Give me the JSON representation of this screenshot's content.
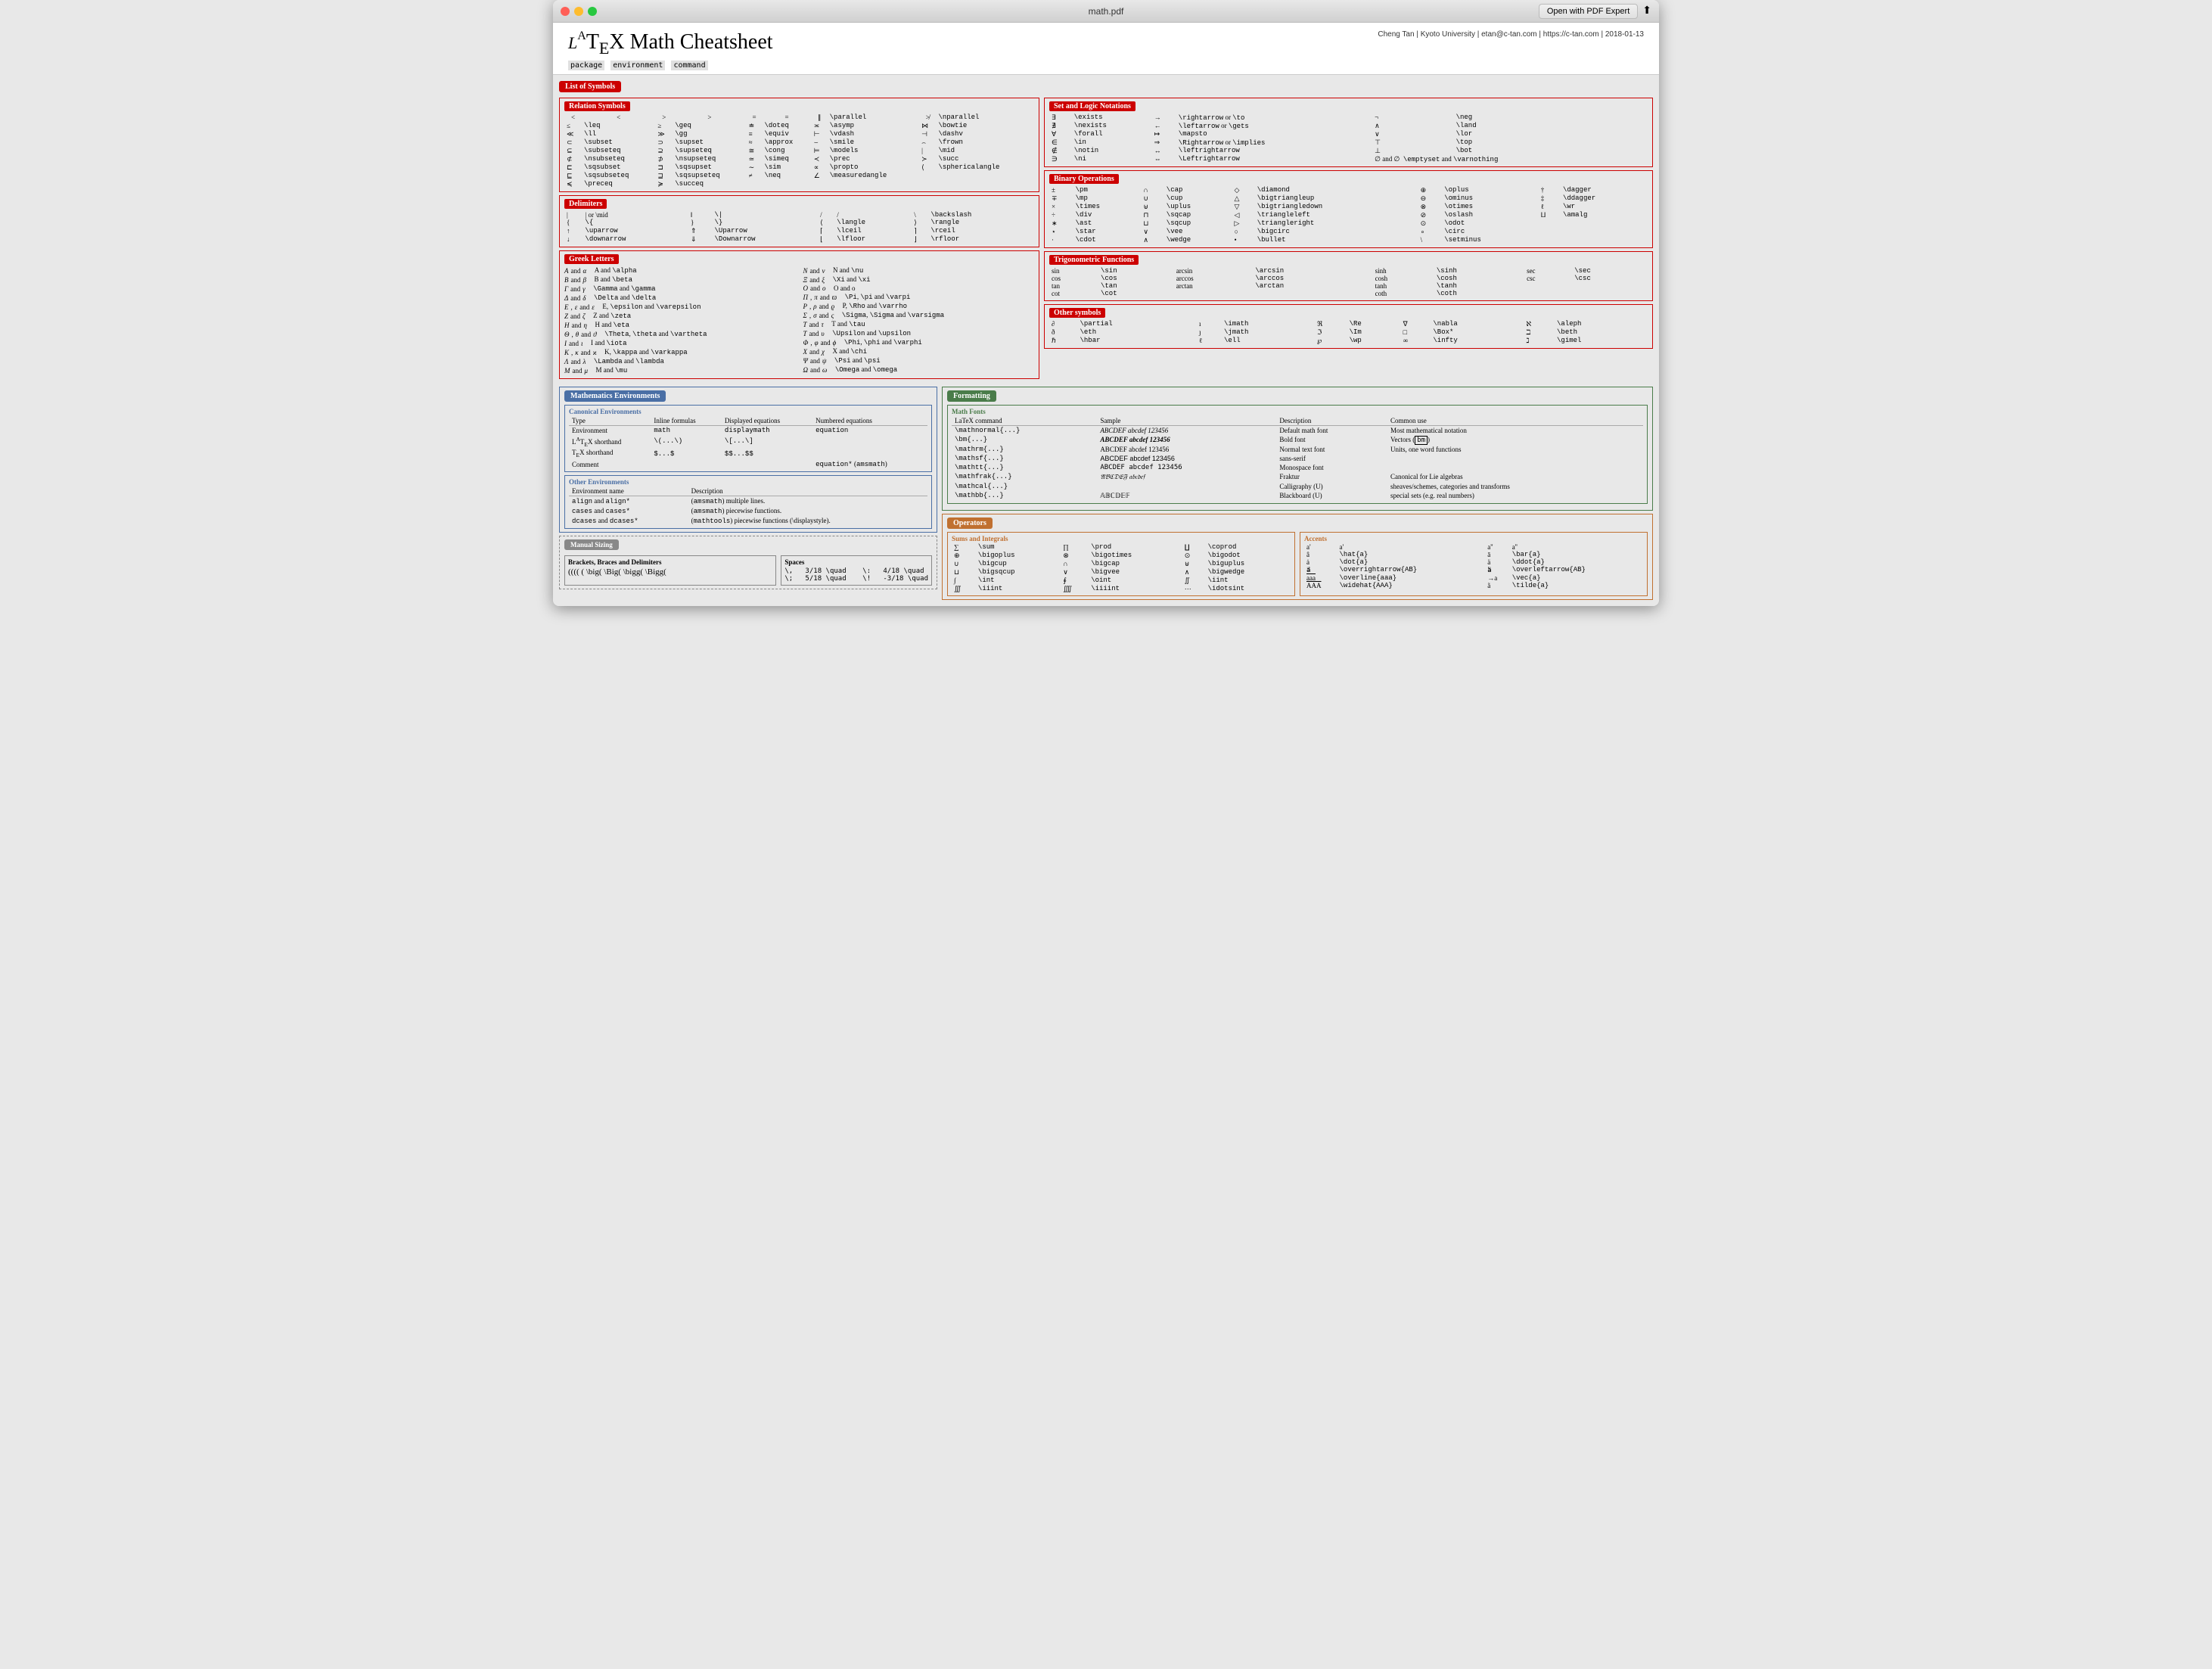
{
  "window": {
    "title": "math.pdf",
    "open_button": "Open with PDF Expert"
  },
  "header": {
    "title": "LaTeX Math Cheatsheet",
    "subtitle": [
      "package",
      "environment",
      "command"
    ],
    "right_text": "Cheng Tan | Kyoto University | etan@c-tan.com | https://c-tan.com | 2018-01-13"
  },
  "sections": {
    "list_of_symbols": "List of Symbols",
    "relation_symbols": "Relation Symbols",
    "delimiters": "Delimiters",
    "greek_letters": "Greek Letters",
    "set_and_logic": "Set and Logic Notations",
    "binary_ops": "Binary Operations",
    "trig": "Trigonometric Functions",
    "other_symbols": "Other symbols",
    "math_envs": "Mathematics Environments",
    "formatting": "Formatting",
    "canonical_envs": "Canonical Environments",
    "other_envs": "Other Environments",
    "manual_sizing": "Manual Sizing",
    "math_fonts": "Math Fonts",
    "operators": "Operators",
    "sums_integrals": "Sums and Integrals",
    "accents": "Accents",
    "brackets": "Brackets, Braces and Delimiters",
    "spaces": "Spaces"
  }
}
